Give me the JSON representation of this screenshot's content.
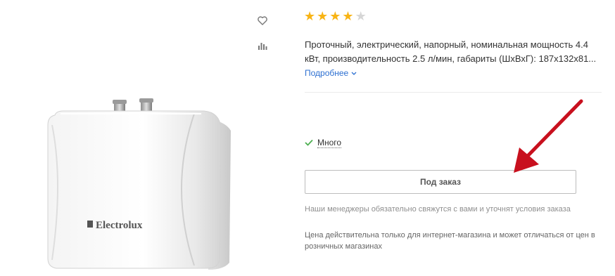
{
  "product": {
    "brand_on_image": "Electrolux",
    "rating": {
      "value": 4,
      "max": 5,
      "color_on": "#f8b415",
      "color_off": "#d6d6d6"
    },
    "description": "Проточный, электрический, напорный, номинальная мощность 4.4 кВт, производительность 2.5 л/мин, габариты (ШхВхГ): 187x132x81...",
    "more_link": "Подробнее",
    "availability": "Много",
    "order_button": "Под заказ",
    "order_note": "Наши менеджеры обязательно свяжутся с вами и уточнят условия заказа",
    "price_note": "Цена действительна только для интернет-магазина и может отличаться от цен в розничных магазинах"
  },
  "icons": {
    "favorite": "heart-icon",
    "compare": "compare-chart-icon",
    "more": "chevron-down-icon",
    "stock": "checkmark-icon",
    "annotation": "red-arrow"
  },
  "colors": {
    "link": "#2c6fd1",
    "check": "#4caf50",
    "arrow": "#c8101e"
  }
}
